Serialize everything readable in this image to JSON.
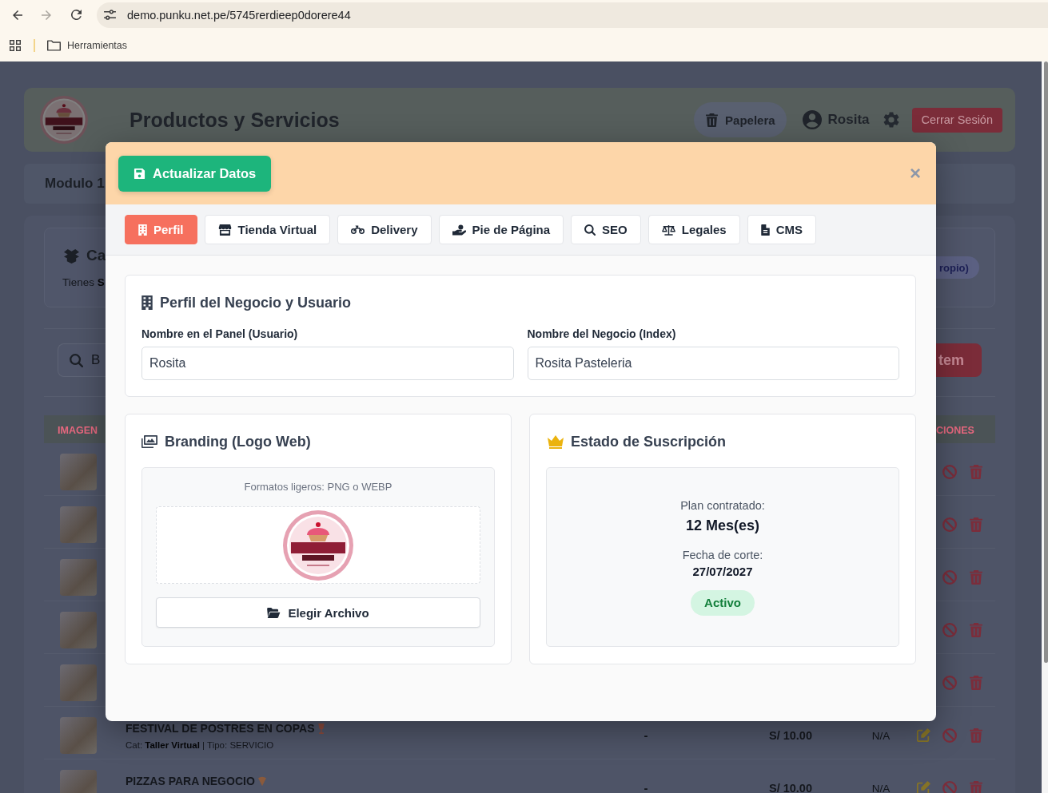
{
  "browser": {
    "url": "demo.punku.net.pe/5745rerdieep0dorere44",
    "bookmarks": [
      {
        "label": "Herramientas"
      }
    ]
  },
  "page": {
    "header": {
      "title": "Productos y Servicios",
      "trash_button": "Papelera",
      "user": "Rosita",
      "logout_button": "Cerrar Sesión"
    },
    "module_bar": {
      "label": "Modulo 1"
    },
    "summary_card": {
      "title": "Ca",
      "text": "Tienes **S**",
      "badge": "ropio)"
    },
    "search": {
      "placeholder": "B",
      "button": "tem"
    },
    "table": {
      "columns": [
        {
          "label": "IMAGEN"
        },
        {
          "label": "CIONES"
        }
      ],
      "rows": [
        {
          "kind": "covered"
        },
        {
          "kind": "covered"
        },
        {
          "kind": "covered"
        },
        {
          "kind": "covered"
        },
        {
          "kind": "covered"
        },
        {
          "kind": "full",
          "name": "FESTIVAL DE POSTRES EN COPAS",
          "details": "Cat: **Taller Virtual** | Tipo: SERVICIO",
          "column_3": "-",
          "price": "S/ 10.00",
          "column_5": "N/A"
        },
        {
          "kind": "full",
          "name": "PIZZAS PARA NEGOCIO",
          "column_3": "-",
          "price": "S/ 10.00",
          "column_5": "N/A"
        }
      ]
    }
  },
  "modal": {
    "save_button": "Actualizar Datos",
    "close": "×",
    "tabs": [
      {
        "label": "Perfil",
        "selected": true
      },
      {
        "label": "Tienda Virtual",
        "selected": false
      },
      {
        "label": "Delivery",
        "selected": false
      },
      {
        "label": "Pie de Página",
        "selected": false
      },
      {
        "label": "SEO",
        "selected": false
      },
      {
        "label": "Legales",
        "selected": false
      },
      {
        "label": "CMS",
        "selected": false
      }
    ],
    "profile_card": {
      "title": "Perfil del Negocio y Usuario",
      "fields": [
        {
          "label": "Nombre en el Panel (Usuario)",
          "value": "Rosita"
        },
        {
          "label": "Nombre del Negocio (Index)",
          "value": "Rosita Pasteleria"
        }
      ]
    },
    "branding_card": {
      "title": "Branding (Logo Web)",
      "hint": "Formatos ligeros: PNG o WEBP",
      "button": "Elegir Archivo"
    },
    "subscription_card": {
      "title": "Estado de Suscripción",
      "plan_label": "Plan contratado:",
      "plan_value": "12 Mes(es)",
      "cutoff_label": "Fecha de corte:",
      "cutoff_value": "27/07/2027",
      "status": "Activo"
    }
  }
}
